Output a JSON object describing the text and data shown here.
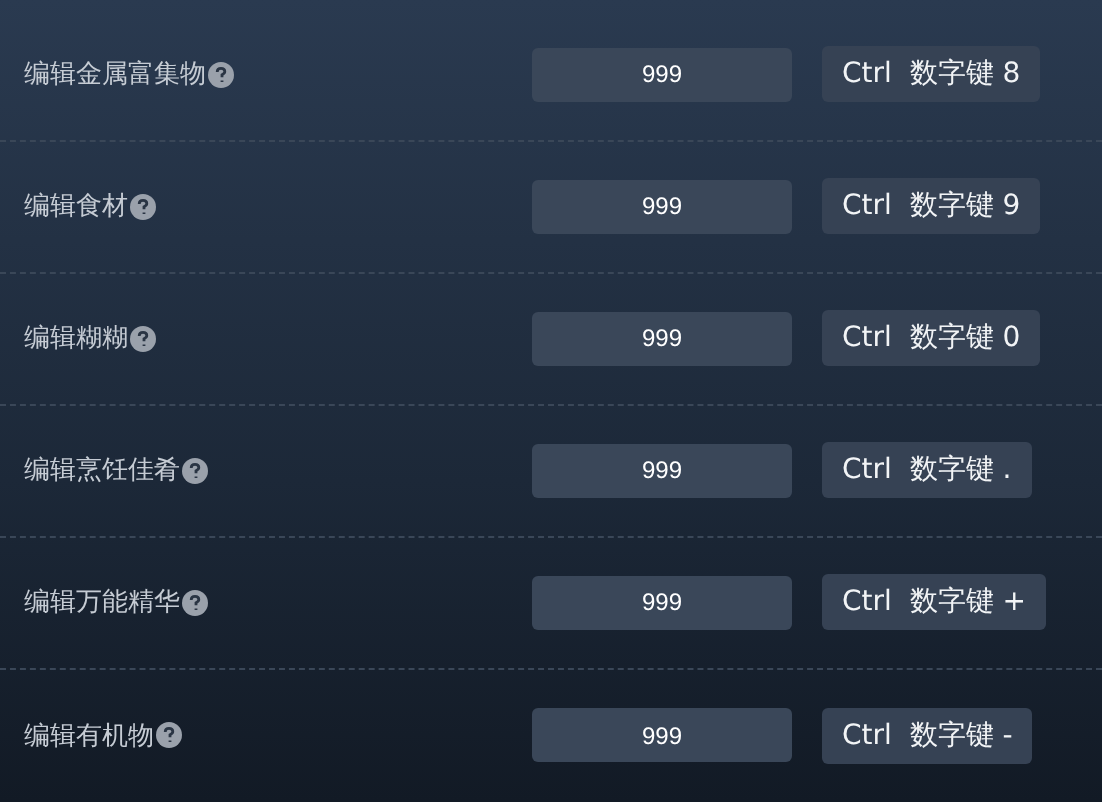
{
  "rows": [
    {
      "label": "编辑金属富集物",
      "value": "999",
      "hotkey": "Ctrl  数字键 8"
    },
    {
      "label": "编辑食材",
      "value": "999",
      "hotkey": "Ctrl  数字键 9"
    },
    {
      "label": "编辑糊糊",
      "value": "999",
      "hotkey": "Ctrl  数字键 0"
    },
    {
      "label": "编辑烹饪佳肴",
      "value": "999",
      "hotkey": "Ctrl  数字键 ."
    },
    {
      "label": "编辑万能精华",
      "value": "999",
      "hotkey": "Ctrl  数字键 +"
    },
    {
      "label": "编辑有机物",
      "value": "999",
      "hotkey": "Ctrl  数字键 -"
    }
  ]
}
